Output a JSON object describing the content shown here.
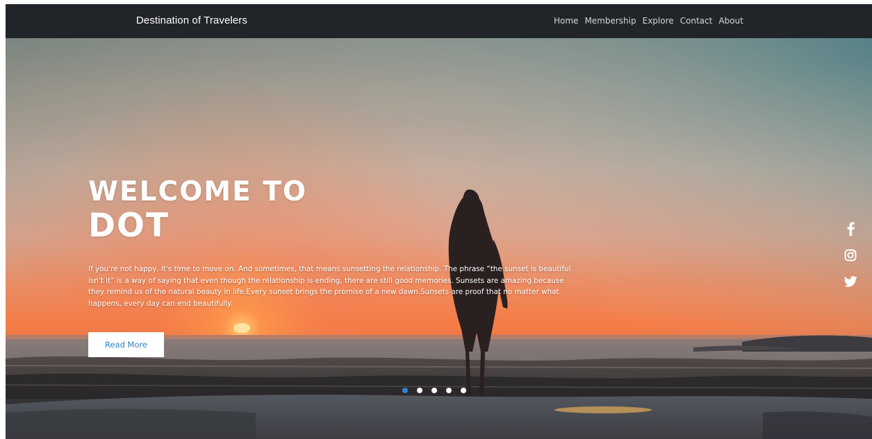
{
  "navbar": {
    "brand": "Destination of Travelers",
    "links": [
      {
        "label": "Home"
      },
      {
        "label": "Membership"
      },
      {
        "label": "Explore"
      },
      {
        "label": "Contact"
      },
      {
        "label": "About"
      }
    ]
  },
  "hero": {
    "title_line1": "WELCOME TO",
    "title_line2": "DOT",
    "description": "If you're not happy, it's time to move on. And sometimes, that means sunsetting the relationship. The phrase “the sunset is beautiful isn't it” is a way of saying that even though the relationship is ending, there are still good memories. Sunsets are amazing because they remind us of the natural beauty in life.Every sunset brings the promise of a new dawn.Sunsets are proof that no matter what happens, every day can end beautifully.",
    "cta_label": "Read More"
  },
  "carousel": {
    "slide_count": 5,
    "active_index": 0
  },
  "social": [
    {
      "icon": "facebook-icon"
    },
    {
      "icon": "instagram-icon"
    },
    {
      "icon": "twitter-icon"
    }
  ],
  "colors": {
    "navbar_bg": "#212529",
    "accent": "#2f86d6",
    "button_text": "#2a85c4"
  }
}
